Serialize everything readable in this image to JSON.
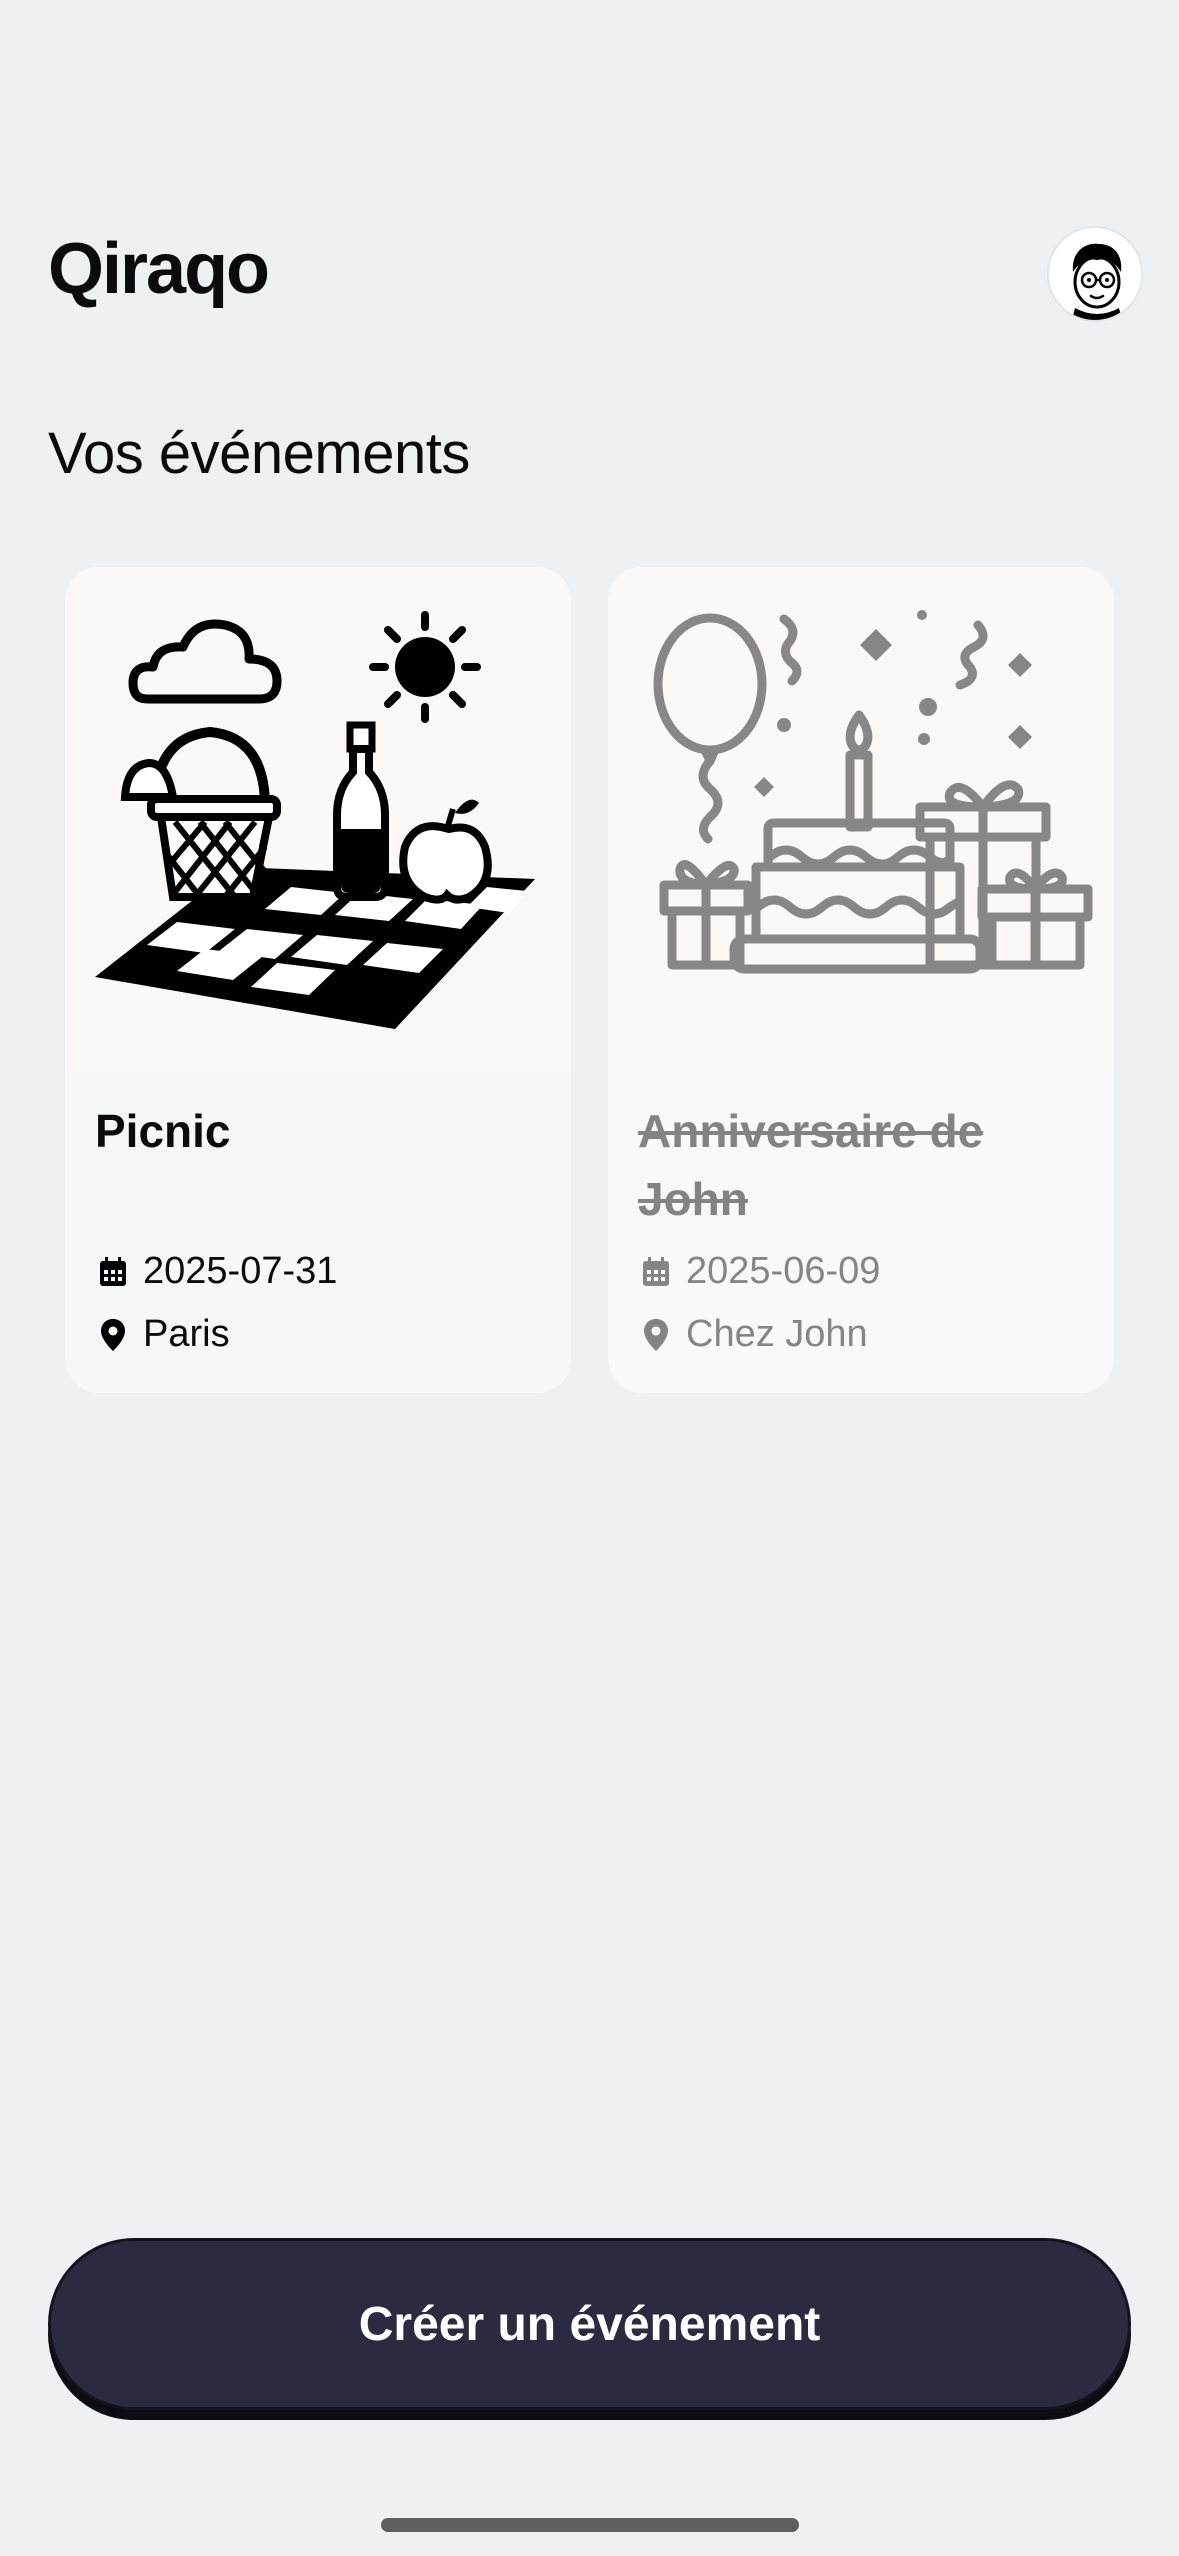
{
  "app": {
    "logo": "Qiraqo"
  },
  "header": {
    "section_title": "Vos événements"
  },
  "events": [
    {
      "title": "Picnic",
      "date": "2025-07-31",
      "location": "Paris",
      "status": "active",
      "image": "picnic-illustration"
    },
    {
      "title": "Anniversaire de John",
      "date": "2025-06-09",
      "location": "Chez John",
      "status": "past",
      "image": "birthday-illustration"
    }
  ],
  "actions": {
    "create_label": "Créer un événement"
  },
  "colors": {
    "background": "#edf1f4",
    "cta": "#2a2b40",
    "muted": "#838383"
  }
}
